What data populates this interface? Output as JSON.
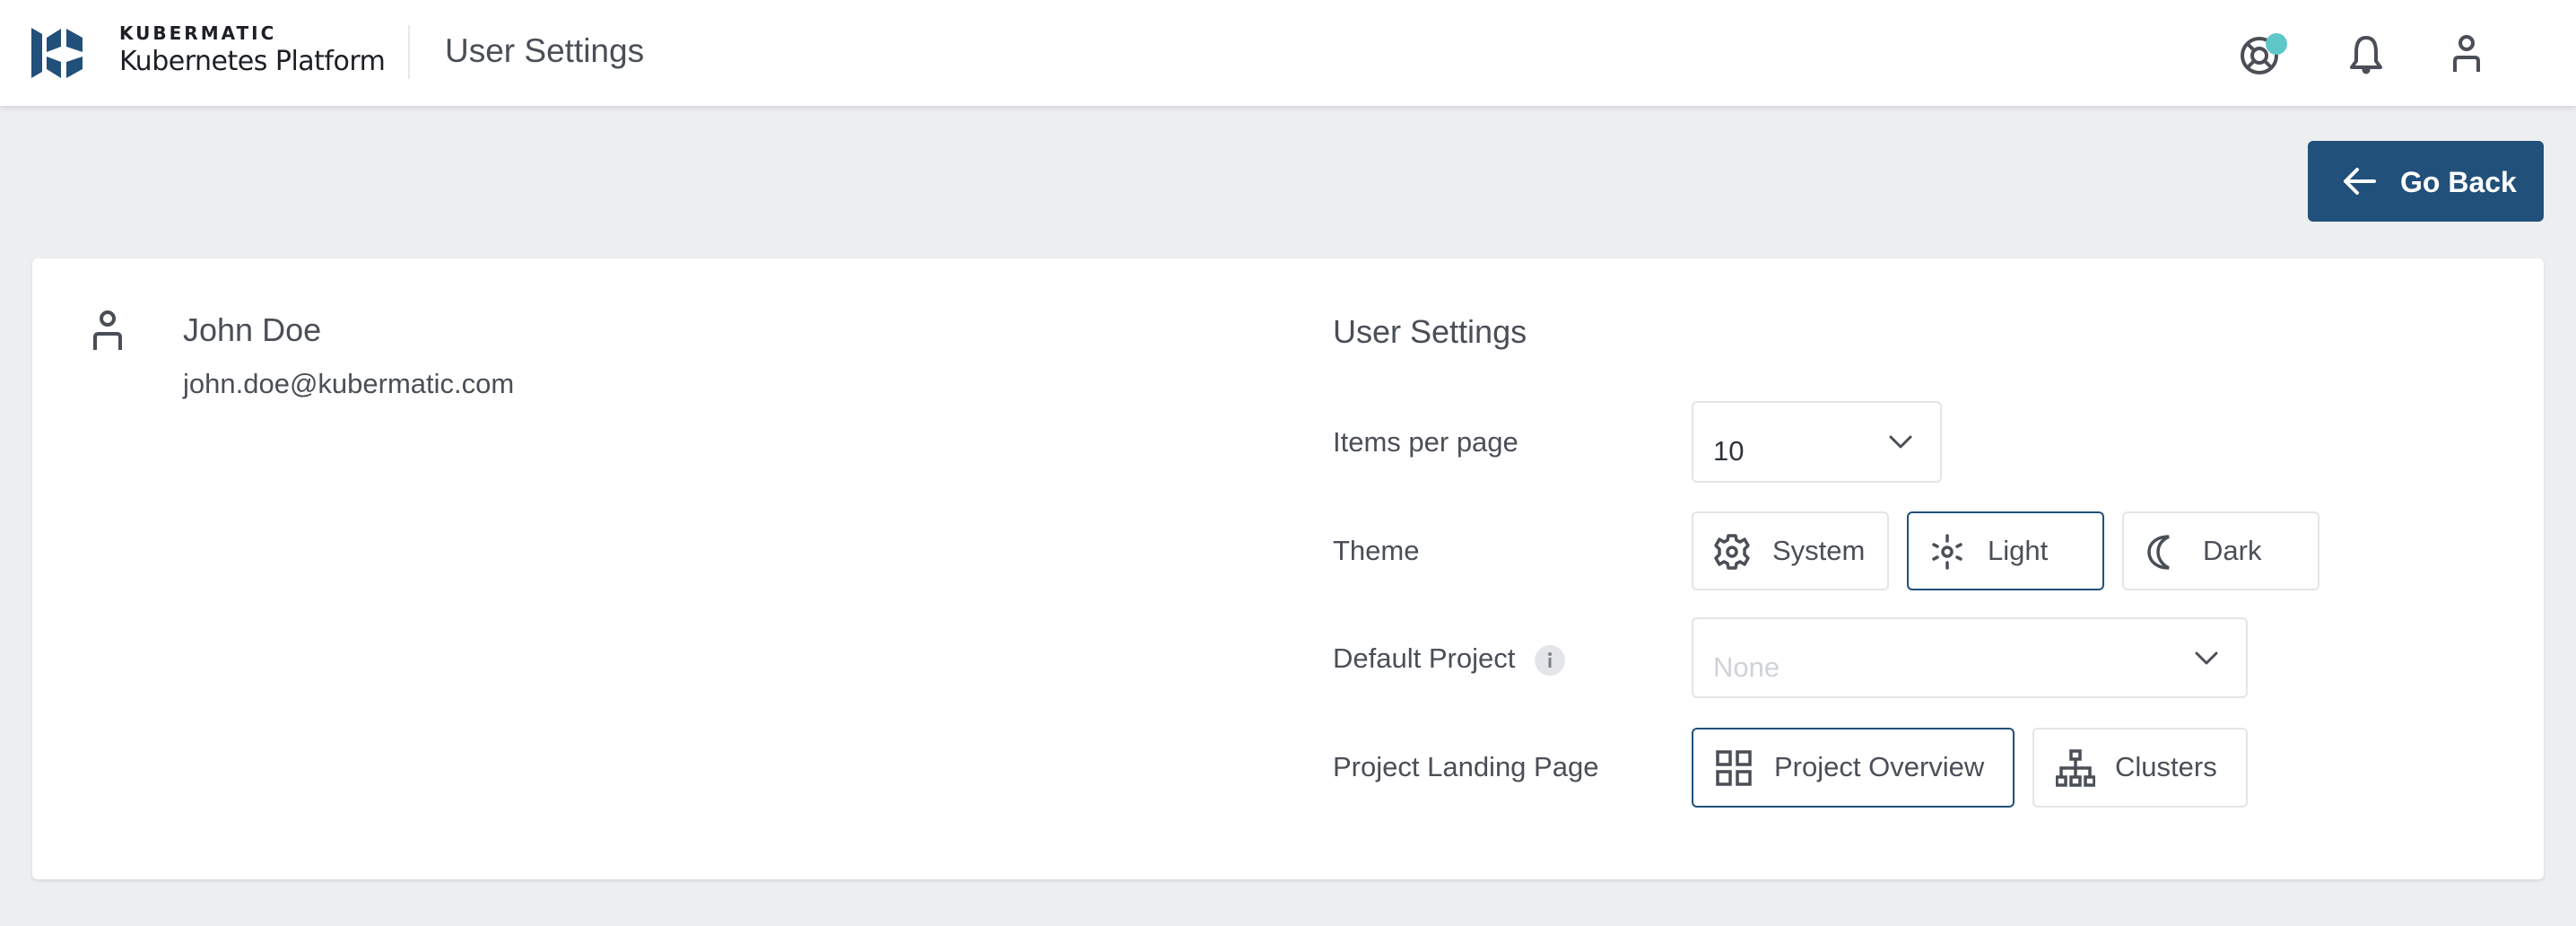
{
  "header": {
    "brand_top": "KUBERMATIC",
    "brand_bottom": "Kubernetes Platform",
    "title": "User Settings",
    "icons": [
      "help-lifebuoy-icon",
      "notifications-bell-icon",
      "account-icon"
    ],
    "help_badge_color": "#5ec8c8"
  },
  "actions": {
    "go_back_label": "Go Back"
  },
  "profile": {
    "name": "John Doe",
    "email": "john.doe@kubermatic.com"
  },
  "settings": {
    "heading": "User Settings",
    "items_per_page": {
      "label": "Items per page",
      "value": "10"
    },
    "theme": {
      "label": "Theme",
      "options": [
        {
          "label": "System",
          "icon": "gear-icon",
          "selected": false
        },
        {
          "label": "Light",
          "icon": "sun-icon",
          "selected": true
        },
        {
          "label": "Dark",
          "icon": "moon-icon",
          "selected": false
        }
      ]
    },
    "default_project": {
      "label": "Default Project",
      "placeholder": "None"
    },
    "project_landing_page": {
      "label": "Project Landing Page",
      "options": [
        {
          "label": "Project Overview",
          "icon": "grid-icon",
          "selected": true
        },
        {
          "label": "Clusters",
          "icon": "hierarchy-icon",
          "selected": false
        }
      ]
    }
  },
  "colors": {
    "accent": "#21507a",
    "background": "#edeef0",
    "text": "#4a4f57",
    "border": "#e3e5e8"
  }
}
